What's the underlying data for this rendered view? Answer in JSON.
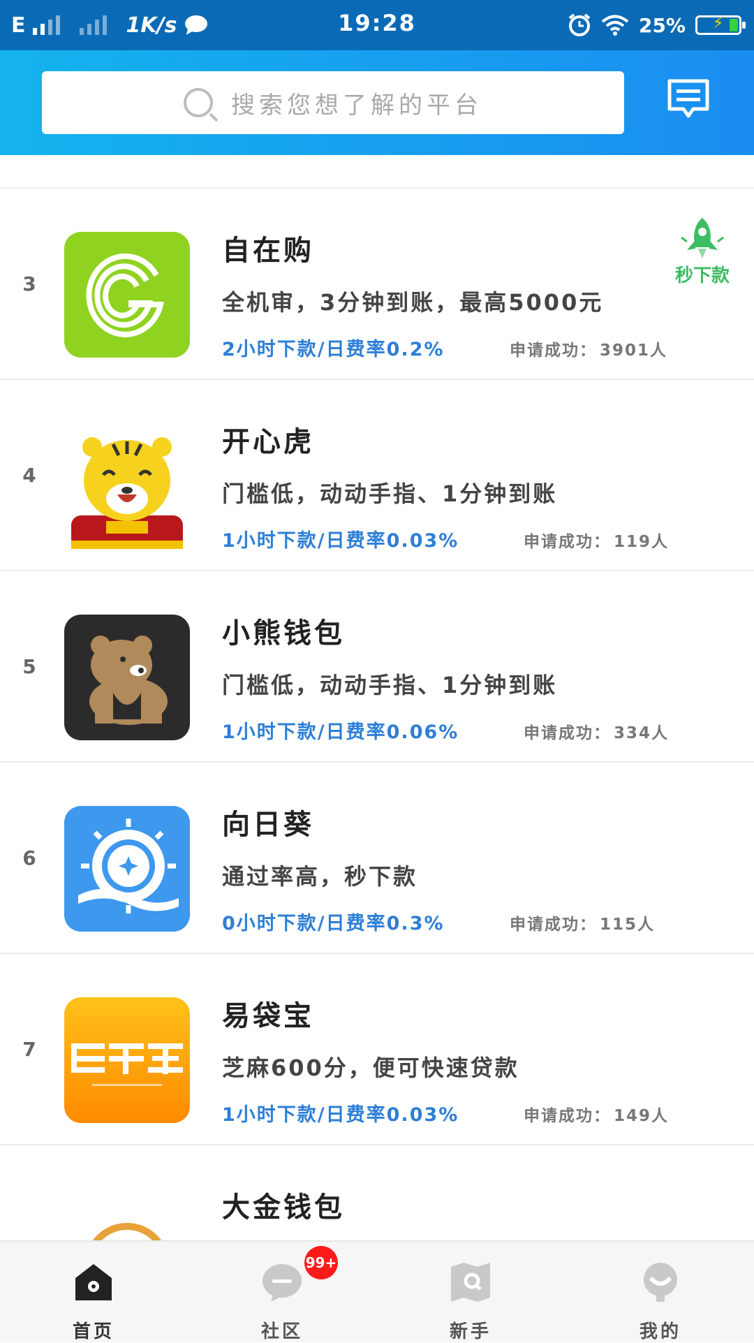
{
  "status_bar": {
    "network": "E",
    "speed": "1K/s",
    "time": "19:28",
    "battery": "25%"
  },
  "header": {
    "search_placeholder": "搜索您想了解的平台"
  },
  "badge": {
    "label": "秒下款"
  },
  "items": [
    {
      "rank": "3",
      "name": "自在购",
      "desc": "全机审，3分钟到账，最高5000元",
      "rate": "2小时下款/日费率0.2%",
      "applied_label": "申请成功：",
      "applied_value": "3901人",
      "logo": "g-logo"
    },
    {
      "rank": "4",
      "name": "开心虎",
      "desc": "门槛低，动动手指、1分钟到账",
      "rate": "1小时下款/日费率0.03%",
      "applied_label": "申请成功：",
      "applied_value": "119人",
      "logo": "tiger-logo"
    },
    {
      "rank": "5",
      "name": "小熊钱包",
      "desc": "门槛低，动动手指、1分钟到账",
      "rate": "1小时下款/日费率0.06%",
      "applied_label": "申请成功：",
      "applied_value": "334人",
      "logo": "bear-logo"
    },
    {
      "rank": "6",
      "name": "向日葵",
      "desc": "通过率高，秒下款",
      "rate": "0小时下款/日费率0.3%",
      "applied_label": "申请成功：",
      "applied_value": "115人",
      "logo": "sun-logo"
    },
    {
      "rank": "7",
      "name": "易袋宝",
      "desc": "芝麻600分，便可快速贷款",
      "rate": "1小时下款/日费率0.03%",
      "applied_label": "申请成功：",
      "applied_value": "149人",
      "logo": "yidaibao-logo"
    },
    {
      "rank": "",
      "name": "大金钱包",
      "logo": "dajin-logo"
    }
  ],
  "tabs": [
    {
      "label": "首页",
      "icon": "home-icon"
    },
    {
      "label": "社区",
      "icon": "chat-icon"
    },
    {
      "label": "新手",
      "icon": "map-icon"
    },
    {
      "label": "我的",
      "icon": "profile-icon"
    }
  ],
  "community_badge": "99+",
  "colors": {
    "accent_blue": "#2e7fd6",
    "header_start": "#14b3ee",
    "header_end": "#1a8df0",
    "badge_green": "#3cbd63",
    "notif_red": "#ff1a1a"
  }
}
